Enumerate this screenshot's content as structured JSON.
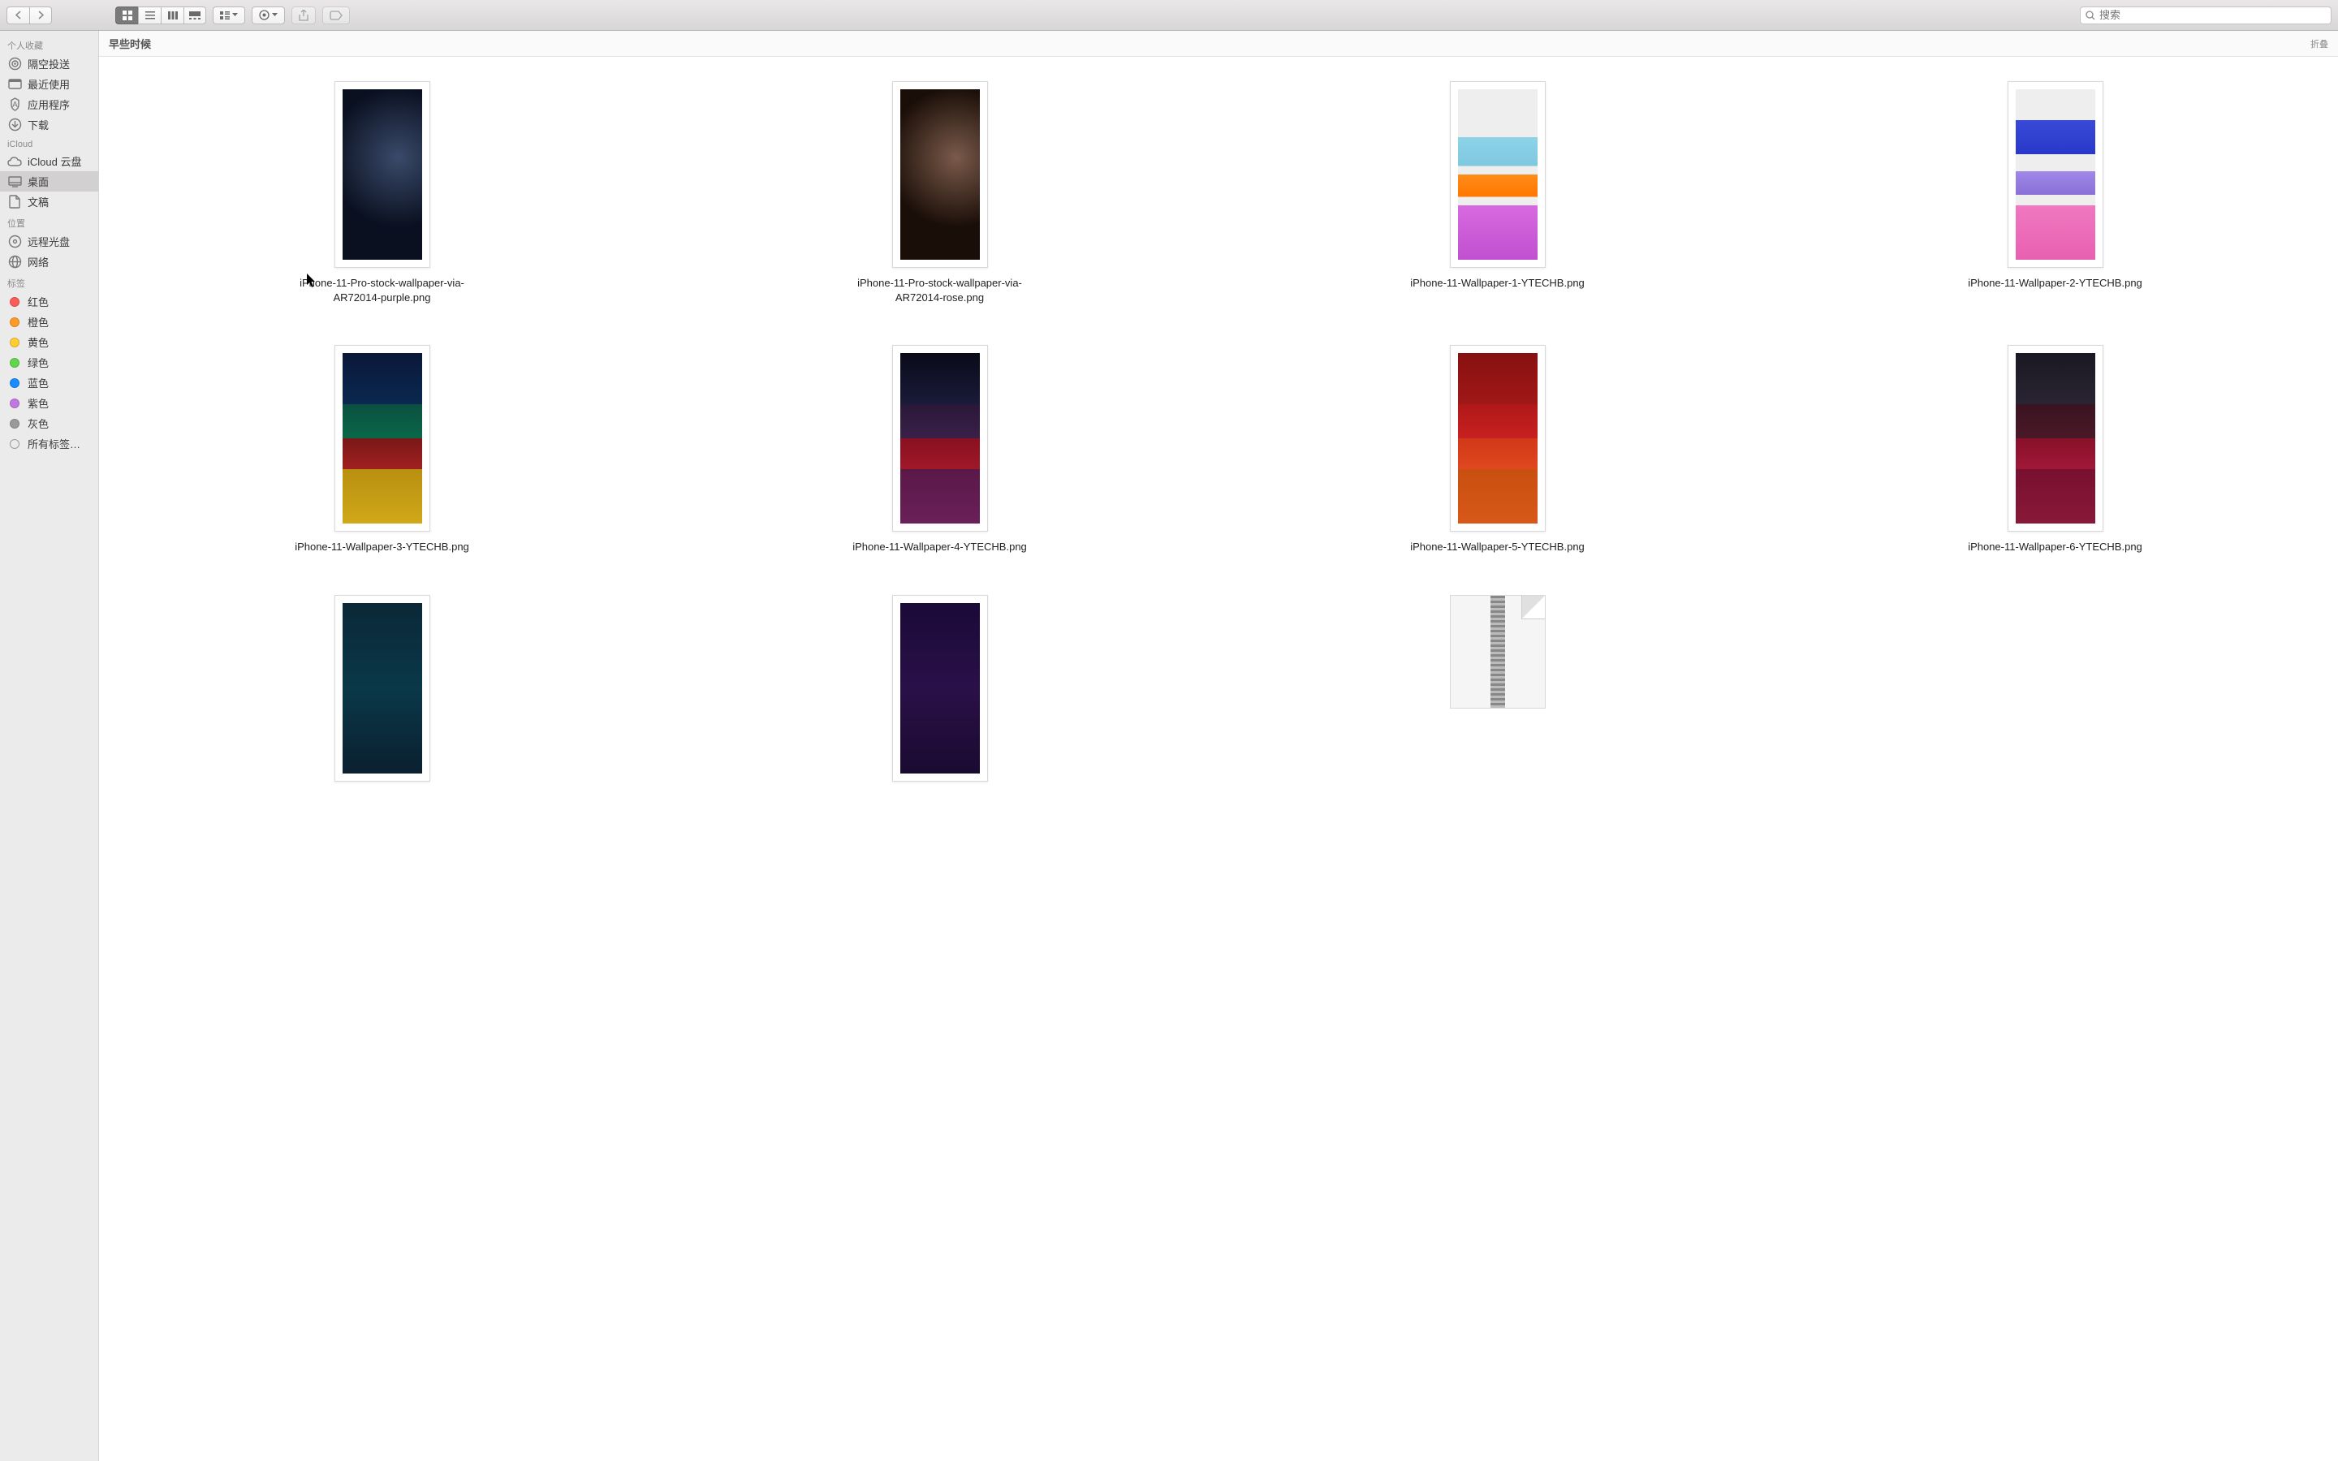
{
  "toolbar": {
    "search_placeholder": "搜索"
  },
  "sidebar": {
    "sections": [
      {
        "header": "个人收藏",
        "items": [
          {
            "label": "隔空投送",
            "icon": "airdrop"
          },
          {
            "label": "最近使用",
            "icon": "recents"
          },
          {
            "label": "应用程序",
            "icon": "apps"
          },
          {
            "label": "下载",
            "icon": "downloads"
          }
        ]
      },
      {
        "header": "iCloud",
        "items": [
          {
            "label": "iCloud 云盘",
            "icon": "icloud"
          },
          {
            "label": "桌面",
            "icon": "desktop",
            "selected": true
          },
          {
            "label": "文稿",
            "icon": "documents"
          }
        ]
      },
      {
        "header": "位置",
        "items": [
          {
            "label": "远程光盘",
            "icon": "disc"
          },
          {
            "label": "网络",
            "icon": "network"
          }
        ]
      },
      {
        "header": "标签",
        "items": [
          {
            "label": "红色",
            "color": "#fc5b57"
          },
          {
            "label": "橙色",
            "color": "#fd9a28"
          },
          {
            "label": "黄色",
            "color": "#fdcd33"
          },
          {
            "label": "绿色",
            "color": "#62d64b"
          },
          {
            "label": "蓝色",
            "color": "#1a8cff"
          },
          {
            "label": "紫色",
            "color": "#c078e0"
          },
          {
            "label": "灰色",
            "color": "#9a9a9a"
          },
          {
            "label": "所有标签…",
            "hollow": true
          }
        ]
      }
    ]
  },
  "content": {
    "header_left": "早些时候",
    "header_right": "折叠",
    "files": [
      {
        "name": "iPhone-11-Pro-stock-wallpaper-via-AR72014-purple.png",
        "wp": "wp1"
      },
      {
        "name": "iPhone-11-Pro-stock-wallpaper-via-AR72014-rose.png",
        "wp": "wp2"
      },
      {
        "name": "iPhone-11-Wallpaper-1-YTECHB.png",
        "wp": "wp3"
      },
      {
        "name": "iPhone-11-Wallpaper-2-YTECHB.png",
        "wp": "wp4"
      },
      {
        "name": "iPhone-11-Wallpaper-3-YTECHB.png",
        "wp": "wp5"
      },
      {
        "name": "iPhone-11-Wallpaper-4-YTECHB.png",
        "wp": "wp6"
      },
      {
        "name": "iPhone-11-Wallpaper-5-YTECHB.png",
        "wp": "wp7"
      },
      {
        "name": "iPhone-11-Wallpaper-6-YTECHB.png",
        "wp": "wp8"
      },
      {
        "name": "",
        "wp": "wp9"
      },
      {
        "name": "",
        "wp": "wp10"
      },
      {
        "name": "",
        "zip": true
      }
    ]
  }
}
